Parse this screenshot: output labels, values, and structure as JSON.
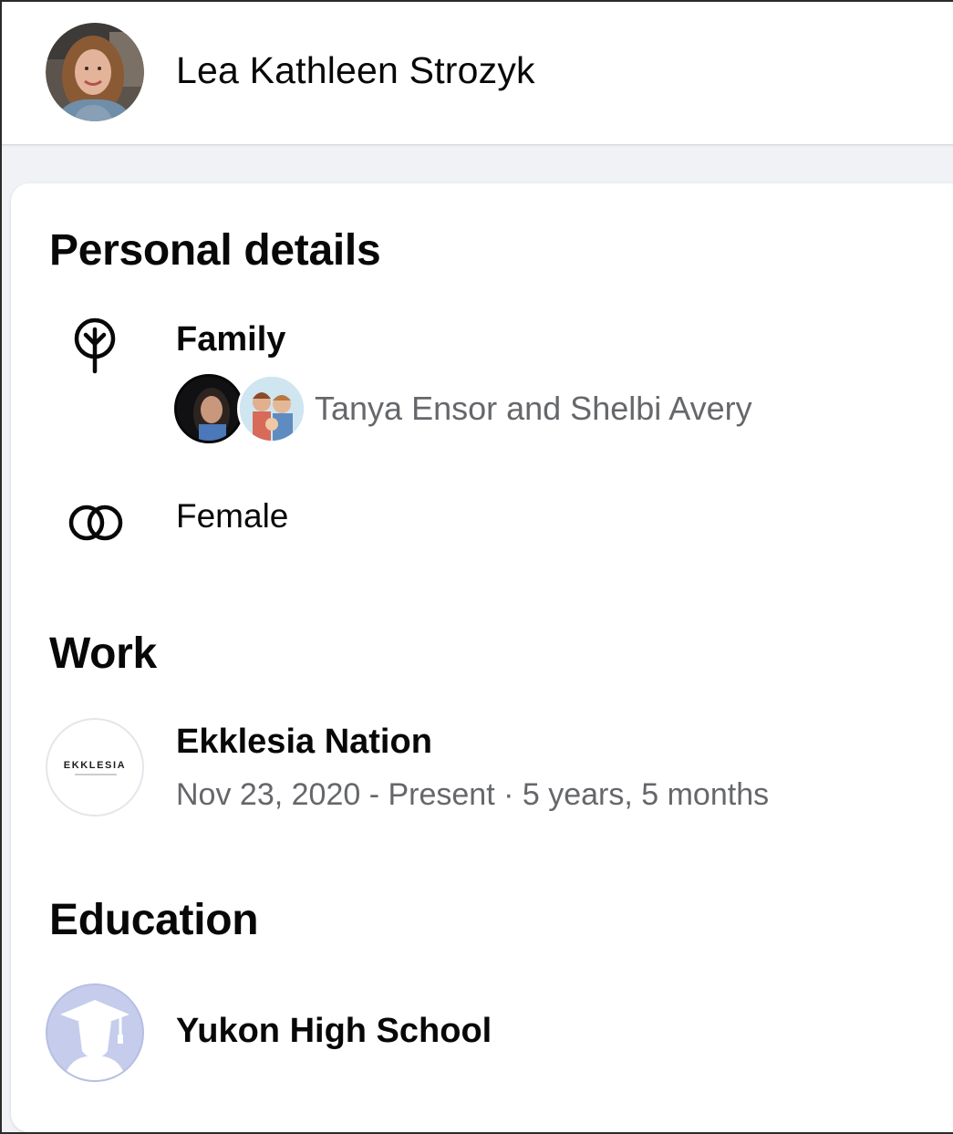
{
  "profile": {
    "name": "Lea Kathleen Strozyk"
  },
  "personal_details": {
    "title": "Personal details",
    "family": {
      "label": "Family",
      "members": "Tanya Ensor and Shelbi Avery"
    },
    "gender": "Female"
  },
  "work": {
    "title": "Work",
    "employer": "Ekklesia Nation",
    "logo_text": "EKKLESIA",
    "dates": "Nov 23, 2020 - Present · 5 years, 5 months"
  },
  "education": {
    "title": "Education",
    "school": "Yukon High School"
  },
  "colors": {
    "text_primary": "#080809",
    "text_secondary": "#65676b",
    "page_background": "#f0f2f5",
    "card_background": "#ffffff",
    "school_avatar": "#c5ccec"
  },
  "icons": [
    "family-tree-icon",
    "gender-rings-icon",
    "ekklesia-logo",
    "graduation-cap-icon"
  ]
}
